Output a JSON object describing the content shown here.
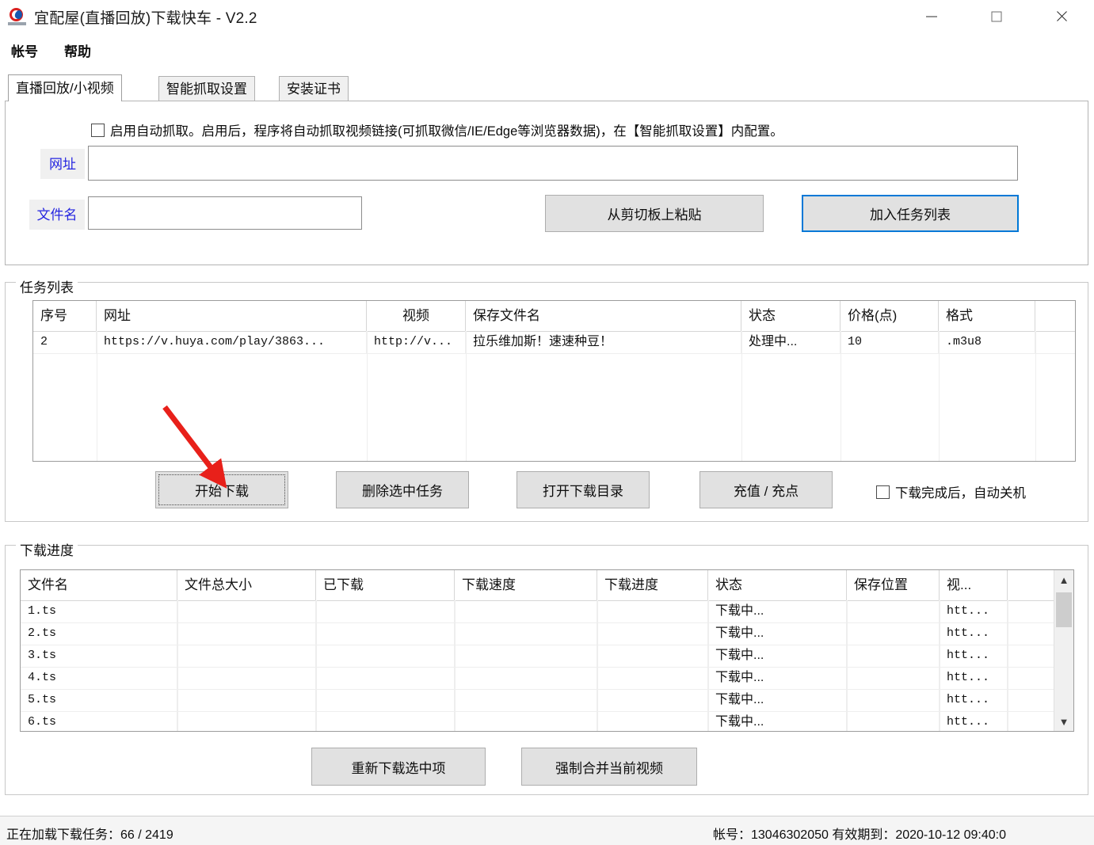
{
  "window": {
    "title": "宜配屋(直播回放)下载快车 - V2.2",
    "logo_icon": "app-logo-icon",
    "controls": {
      "minimize": "minimize-icon",
      "maximize": "maximize-icon",
      "close": "close-icon"
    }
  },
  "menubar": {
    "items": [
      {
        "label": "帐号"
      },
      {
        "label": "帮助"
      }
    ]
  },
  "tabs": [
    {
      "label": "直播回放/小视频",
      "active": true
    },
    {
      "label": "智能抓取设置",
      "active": false
    },
    {
      "label": "安装证书",
      "active": false
    }
  ],
  "auto_capture": {
    "checked": false,
    "label": "启用自动抓取。启用后，程序将自动抓取视频链接(可抓取微信/IE/Edge等浏览器数据)，在【智能抓取设置】内配置。"
  },
  "form": {
    "url_label": "网址",
    "url_value": "",
    "url_placeholder": "",
    "filename_label": "文件名",
    "filename_value": "",
    "filename_placeholder": "",
    "paste_button": "从剪切板上粘贴",
    "add_button": "加入任务列表"
  },
  "task_list": {
    "title": "任务列表",
    "columns": [
      "序号",
      "网址",
      "视频",
      "保存文件名",
      "状态",
      "价格(点)",
      "格式"
    ],
    "rows": [
      {
        "seq": "2",
        "url": "https://v.huya.com/play/3863...",
        "video": "http://v...",
        "save_name": "拉乐维加斯！速速种豆！",
        "status": "处理中...",
        "price": "10",
        "format": ".m3u8"
      }
    ],
    "buttons": {
      "start": "开始下载",
      "delete": "删除选中任务",
      "open_dir": "打开下载目录",
      "recharge": "充值 / 充点"
    },
    "auto_shutdown": {
      "checked": false,
      "label": "下载完成后，自动关机"
    }
  },
  "download_progress": {
    "title": "下载进度",
    "columns": [
      "文件名",
      "文件总大小",
      "已下载",
      "下载速度",
      "下载进度",
      "状态",
      "保存位置",
      "视..."
    ],
    "rows": [
      {
        "name": "1.ts",
        "total": "",
        "done": "",
        "speed": "",
        "progress": "",
        "status": "下载中...",
        "location": "",
        "video": "htt..."
      },
      {
        "name": "2.ts",
        "total": "",
        "done": "",
        "speed": "",
        "progress": "",
        "status": "下载中...",
        "location": "",
        "video": "htt..."
      },
      {
        "name": "3.ts",
        "total": "",
        "done": "",
        "speed": "",
        "progress": "",
        "status": "下载中...",
        "location": "",
        "video": "htt..."
      },
      {
        "name": "4.ts",
        "total": "",
        "done": "",
        "speed": "",
        "progress": "",
        "status": "下载中...",
        "location": "",
        "video": "htt..."
      },
      {
        "name": "5.ts",
        "total": "",
        "done": "",
        "speed": "",
        "progress": "",
        "status": "下载中...",
        "location": "",
        "video": "htt..."
      },
      {
        "name": "6.ts",
        "total": "",
        "done": "",
        "speed": "",
        "progress": "",
        "status": "下载中...",
        "location": "",
        "video": "htt..."
      }
    ],
    "scroll_up_icon": "chevron-up-icon",
    "scroll_down_icon": "chevron-down-icon",
    "buttons": {
      "redownload": "重新下载选中项",
      "force_merge": "强制合并当前视频"
    }
  },
  "statusbar": {
    "left": "正在加载下载任务：66 / 2419",
    "right": "帐号：13046302050 有效期到：2020-10-12 09:40:0"
  },
  "annotation": {
    "arrow_color": "#e8201a",
    "arrow_target": "开始下载"
  }
}
